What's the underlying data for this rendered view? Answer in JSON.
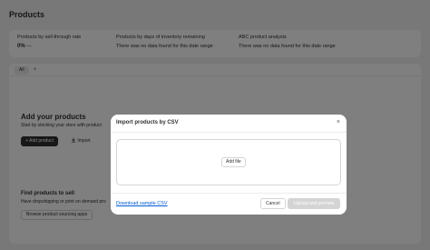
{
  "page": {
    "title": "Products"
  },
  "metrics": [
    {
      "label": "Products by sell-through rate",
      "value": "0%",
      "trend": "—"
    },
    {
      "label": "Products by days of inventory remaining",
      "value": "There was no data found for this date range"
    },
    {
      "label": "ABC product analysis",
      "value": "There was no data found for this date range"
    }
  ],
  "tabs": {
    "all_label": "All",
    "add_label": "+"
  },
  "empty_state": {
    "title": "Add your products",
    "subtitle": "Start by stocking your store with product",
    "add_button": "+ Add product",
    "import_button": "Import",
    "import_icon": "download-icon"
  },
  "find": {
    "title": "Find products to sell",
    "subtitle": "Have dropshipping or print on demand pro",
    "browse_button": "Browse product sourcing apps"
  },
  "modal": {
    "title": "Import products by CSV",
    "close_label": "×",
    "add_file_label": "Add file",
    "sample_link": "Download sample CSV",
    "cancel_label": "Cancel",
    "upload_label": "Upload and preview"
  },
  "colors": {
    "primary": "#303030",
    "link": "#005bd3",
    "disabled": "#d4d4d4",
    "background": "#f1f1f1"
  }
}
